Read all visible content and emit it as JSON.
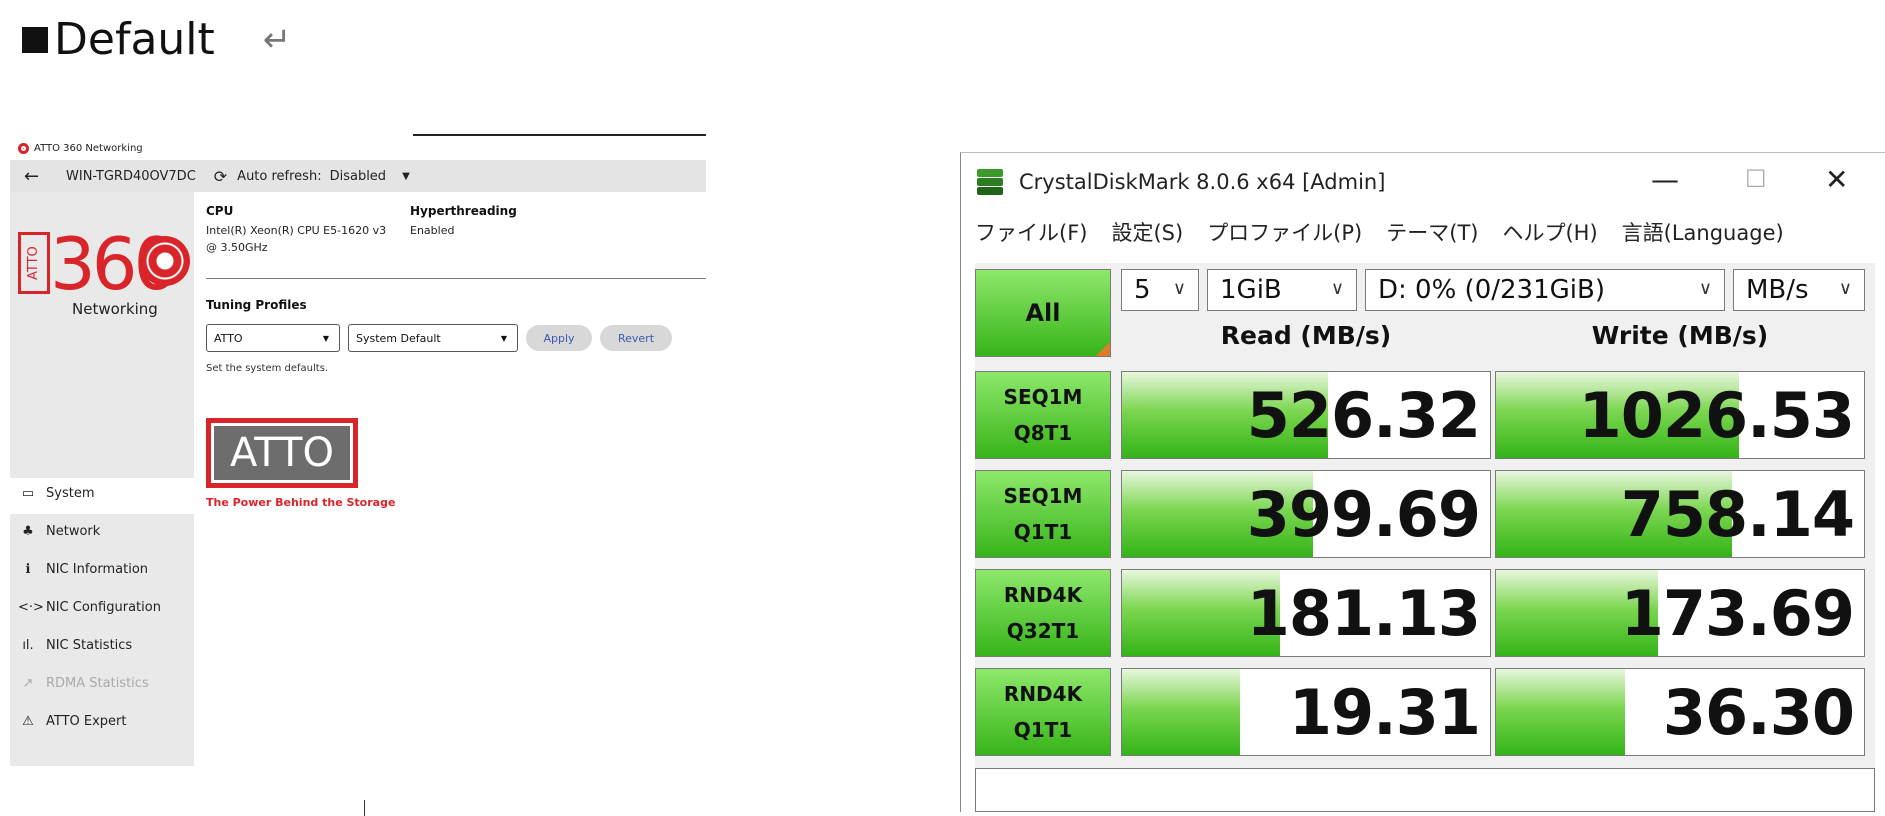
{
  "heading": {
    "marker": "■",
    "text": "Default",
    "return_glyph": "↵"
  },
  "atto": {
    "window_title": "ATTO 360 Networking",
    "toolbar": {
      "back_glyph": "←",
      "host": "WIN-TGRD40OV7DC",
      "refresh_glyph": "⟳",
      "auto_refresh_label": "Auto refresh:",
      "auto_refresh_value": "Disabled",
      "dropdown_glyph": "▼"
    },
    "logo": {
      "box_text": "ATTO",
      "number": "360",
      "subtitle": "Networking"
    },
    "nav": [
      {
        "label": "System",
        "icon": "▭"
      },
      {
        "label": "Network",
        "icon": "♣"
      },
      {
        "label": "NIC Information",
        "icon": "ℹ"
      },
      {
        "label": "NIC Configuration",
        "icon": "<·>"
      },
      {
        "label": "NIC Statistics",
        "icon": "ıl."
      },
      {
        "label": "RDMA Statistics",
        "icon": "↗"
      },
      {
        "label": "ATTO Expert",
        "icon": "⚠"
      }
    ],
    "cpu": {
      "label": "CPU",
      "value_line1": "Intel(R) Xeon(R) CPU E5-1620 v3",
      "value_line2": "@ 3.50GHz"
    },
    "hyperthreading": {
      "label": "Hyperthreading",
      "value": "Enabled"
    },
    "tuning": {
      "label": "Tuning Profiles",
      "profile_select": "ATTO",
      "default_select": "System Default",
      "apply": "Apply",
      "revert": "Revert",
      "help": "Set the system defaults."
    },
    "brand": {
      "text": "ATTO",
      "tagline": "The Power Behind the Storage"
    }
  },
  "cdm": {
    "title": "CrystalDiskMark 8.0.6 x64 [Admin]",
    "window_buttons": {
      "minimize": "—",
      "maximize": "☐",
      "close": "✕"
    },
    "menu": [
      "ファイル(F)",
      "設定(S)",
      "プロファイル(P)",
      "テーマ(T)",
      "ヘルプ(H)",
      "言語(Language)"
    ],
    "all_button": "All",
    "count": "5",
    "size": "1GiB",
    "drive": "D: 0% (0/231GiB)",
    "unit": "MB/s",
    "chevron": "∨",
    "headers": {
      "read": "Read (MB/s)",
      "write": "Write (MB/s)"
    },
    "accent_green": "#37b41a",
    "rows": [
      {
        "line1": "SEQ1M",
        "line2": "Q8T1",
        "read": "526.32",
        "write": "1026.53",
        "read_fill_pct": 56,
        "write_fill_pct": 66
      },
      {
        "line1": "SEQ1M",
        "line2": "Q1T1",
        "read": "399.69",
        "write": "758.14",
        "read_fill_pct": 52,
        "write_fill_pct": 64
      },
      {
        "line1": "RND4K",
        "line2": "Q32T1",
        "read": "181.13",
        "write": "173.69",
        "read_fill_pct": 43,
        "write_fill_pct": 44
      },
      {
        "line1": "RND4K",
        "line2": "Q1T1",
        "read": "19.31",
        "write": "36.30",
        "read_fill_pct": 32,
        "write_fill_pct": 35
      }
    ]
  }
}
